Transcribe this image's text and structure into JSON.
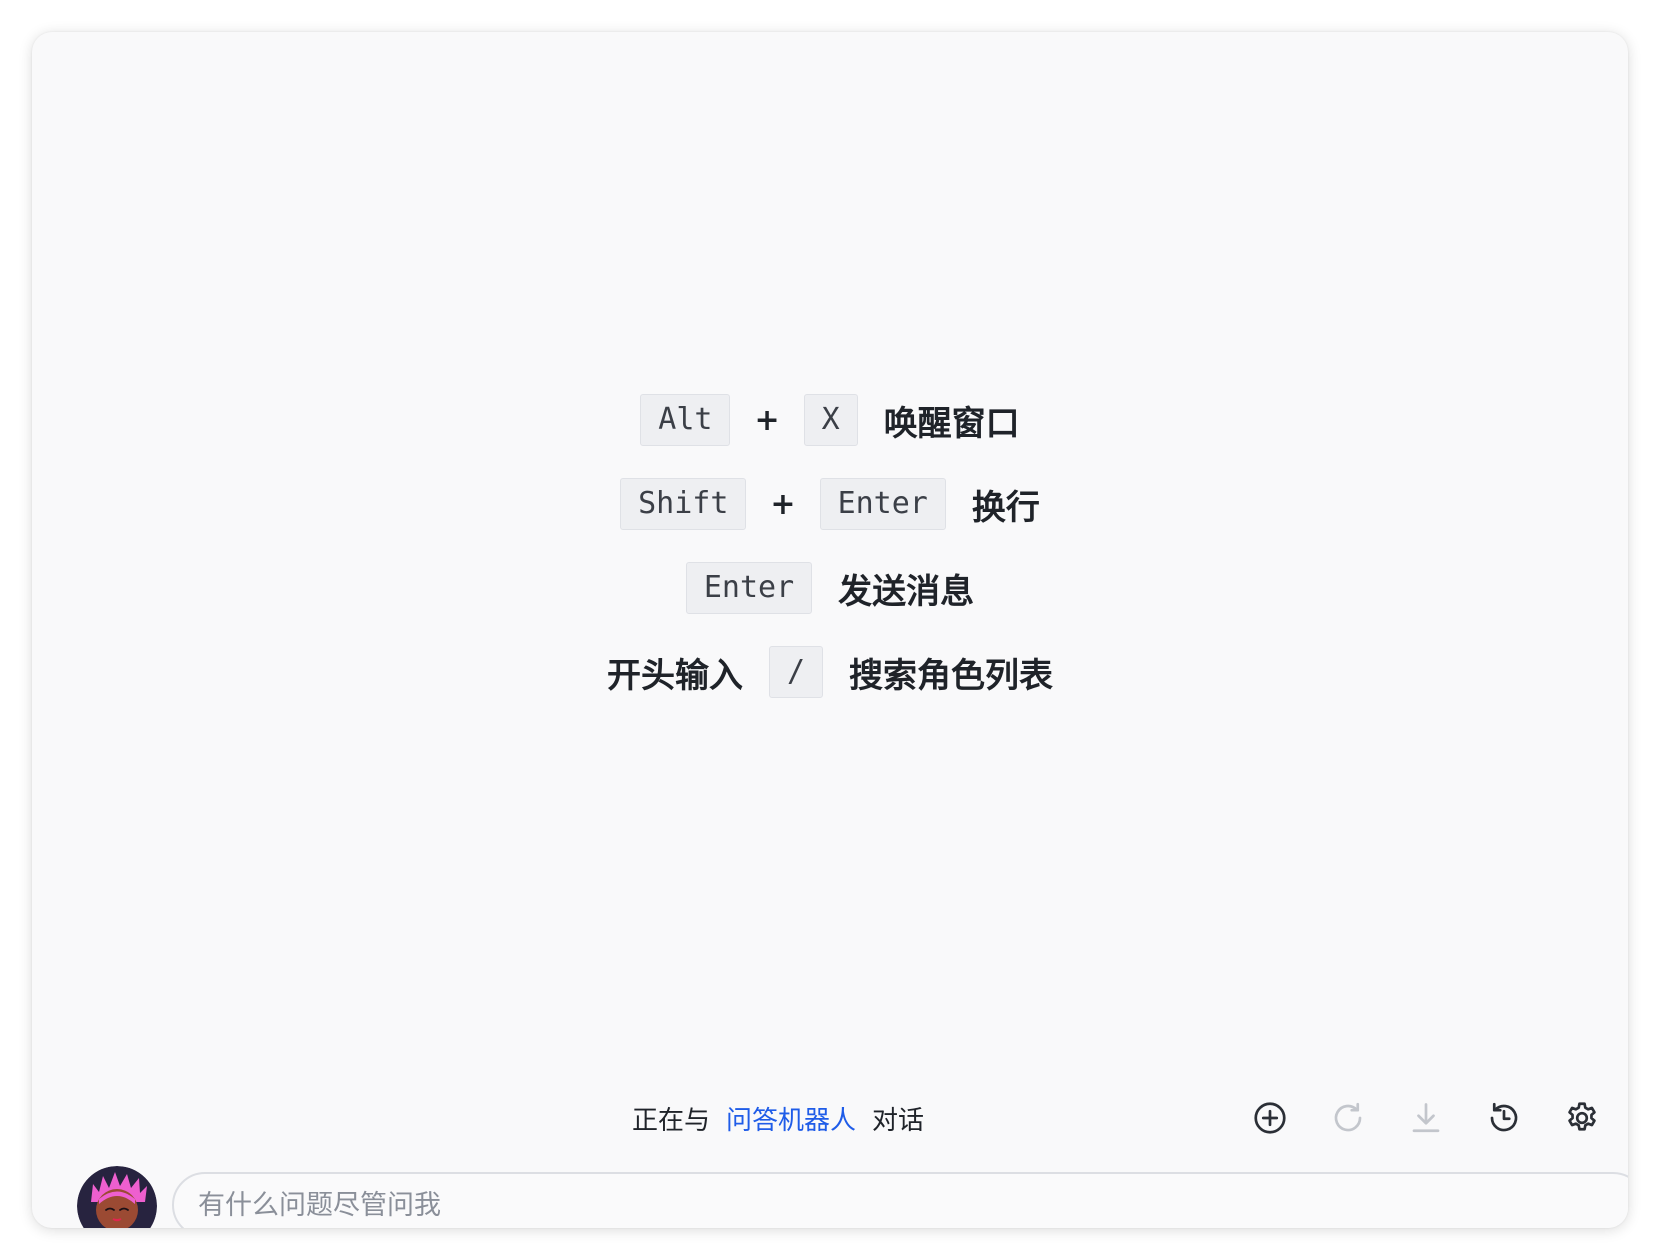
{
  "shortcuts": {
    "row1": {
      "key1": "Alt",
      "plus": "+",
      "key2": "X",
      "desc": "唤醒窗口"
    },
    "row2": {
      "key1": "Shift",
      "plus": "+",
      "key2": "Enter",
      "desc": "换行"
    },
    "row3": {
      "key1": "Enter",
      "desc": "发送消息"
    },
    "row4": {
      "prefix": "开头输入",
      "key1": "/",
      "desc": "搜索角色列表"
    }
  },
  "status": {
    "prefix": "正在与",
    "bot_name": "问答机器人",
    "suffix": "对话"
  },
  "toolbar": {
    "icons": [
      "add-circle-icon",
      "refresh-icon",
      "download-icon",
      "history-icon",
      "settings-icon"
    ],
    "active_color": "#2b2f36",
    "disabled_color": "#c3c6cc"
  },
  "input": {
    "placeholder": "有什么问题尽管问我",
    "value": ""
  },
  "colors": {
    "accent": "#1f5ce8",
    "background": "#f9f9fa",
    "kbd_background": "#eeeff2"
  }
}
